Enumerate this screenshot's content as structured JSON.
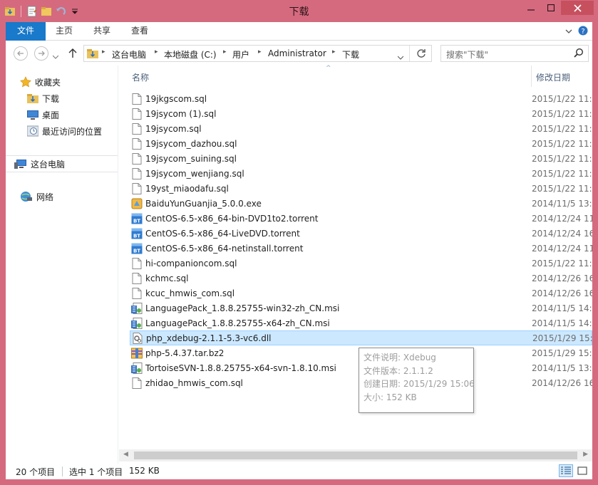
{
  "window": {
    "title": "下载"
  },
  "ribbon": {
    "tabs": [
      "文件",
      "主页",
      "共享",
      "查看"
    ]
  },
  "address": {
    "crumbs": [
      "这台电脑",
      "本地磁盘 (C:)",
      "用户",
      "Administrator",
      "下载"
    ]
  },
  "search": {
    "placeholder": "搜索\"下载\""
  },
  "nav": {
    "favorites": "收藏夹",
    "fav_items": [
      "下载",
      "桌面",
      "最近访问的位置"
    ],
    "this_pc": "这台电脑",
    "network": "网络"
  },
  "columns": {
    "name": "名称",
    "date": "修改日期"
  },
  "files": [
    {
      "name": "19jkgscom.sql",
      "date": "2015/1/22 11:",
      "icon": "document-icon"
    },
    {
      "name": "19jsycom (1).sql",
      "date": "2015/1/22 11:",
      "icon": "document-icon"
    },
    {
      "name": "19jsycom.sql",
      "date": "2015/1/22 11:",
      "icon": "document-icon"
    },
    {
      "name": "19jsycom_dazhou.sql",
      "date": "2015/1/22 11:",
      "icon": "document-icon"
    },
    {
      "name": "19jsycom_suining.sql",
      "date": "2015/1/22 11:",
      "icon": "document-icon"
    },
    {
      "name": "19jsycom_wenjiang.sql",
      "date": "2015/1/22 11:",
      "icon": "document-icon"
    },
    {
      "name": "19yst_miaodafu.sql",
      "date": "2015/1/22 11:",
      "icon": "document-icon"
    },
    {
      "name": "BaiduYunGuanjia_5.0.0.exe",
      "date": "2014/11/5 13:",
      "icon": "installer-icon"
    },
    {
      "name": "CentOS-6.5-x86_64-bin-DVD1to2.torrent",
      "date": "2014/12/24 11",
      "icon": "torrent-icon"
    },
    {
      "name": "CentOS-6.5-x86_64-LiveDVD.torrent",
      "date": "2014/12/24 16",
      "icon": "torrent-icon"
    },
    {
      "name": "CentOS-6.5-x86_64-netinstall.torrent",
      "date": "2014/12/24 11",
      "icon": "torrent-icon"
    },
    {
      "name": "hi-companioncom.sql",
      "date": "2015/1/22 11:",
      "icon": "document-icon"
    },
    {
      "name": "kchmc.sql",
      "date": "2014/12/26 16",
      "icon": "document-icon"
    },
    {
      "name": "kcuc_hmwis_com.sql",
      "date": "2014/12/26 16",
      "icon": "document-icon"
    },
    {
      "name": "LanguagePack_1.8.8.25755-win32-zh_CN.msi",
      "date": "2014/11/5 14:",
      "icon": "msi-icon"
    },
    {
      "name": "LanguagePack_1.8.8.25755-x64-zh_CN.msi",
      "date": "2014/11/5 14:",
      "icon": "msi-icon"
    },
    {
      "name": "php_xdebug-2.1.1-5.3-vc6.dll",
      "date": "2015/1/29 15:",
      "icon": "dll-icon"
    },
    {
      "name": "php-5.4.37.tar.bz2",
      "date": "2015/1/29 15:",
      "icon": "archive-icon"
    },
    {
      "name": "TortoiseSVN-1.8.8.25755-x64-svn-1.8.10.msi",
      "date": "2014/11/5 13:",
      "icon": "msi-icon"
    },
    {
      "name": "zhidao_hmwis_com.sql",
      "date": "2014/12/26 16",
      "icon": "document-icon"
    }
  ],
  "selected_index": 16,
  "tooltip": {
    "desc": "文件说明: Xdebug",
    "version": "文件版本: 2.1.1.2",
    "created": "创建日期: 2015/1/29 15:06",
    "size": "大小: 152 KB"
  },
  "status": {
    "count": "20 个项目",
    "selected": "选中 1 个项目",
    "size": "152 KB"
  },
  "colors": {
    "accent": "#1979ca",
    "titlebar": "#d56a7f",
    "selection": "#cce8ff"
  }
}
